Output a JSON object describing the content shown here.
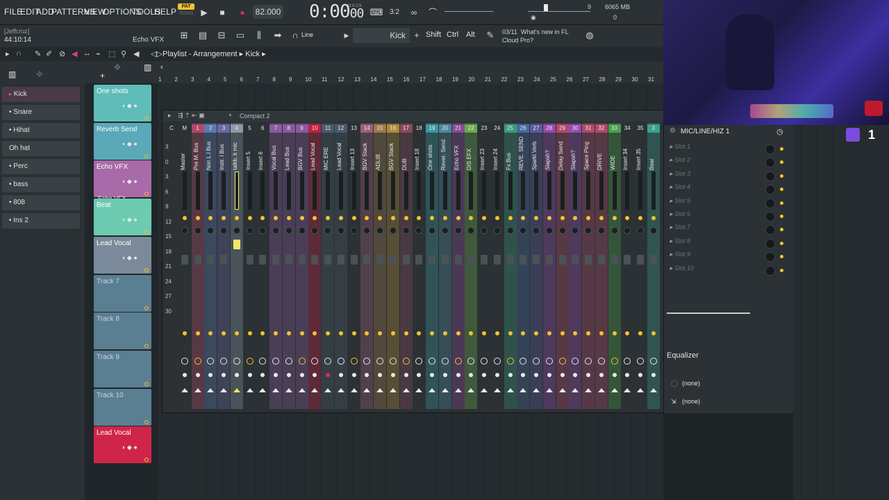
{
  "menu": [
    "FILE",
    "EDIT",
    "ADD",
    "PATTERNS",
    "VIEW",
    "OPTIONS",
    "TOOLS",
    "HELP"
  ],
  "transport": {
    "pat": "PAT",
    "song": "SONG",
    "tempo": "82.000",
    "time": "0:00",
    "time_small": "00",
    "mscs": "M:S:CS"
  },
  "monitor": {
    "cpu_label": "9",
    "mem": "6065 MB",
    "poly": "0"
  },
  "user": "[Jeffcruz]",
  "clock": "44:10:14",
  "focused_channel": "Echo VFX",
  "snap": "Line",
  "pattern_name": "Kick",
  "modkeys": [
    "Shift",
    "Ctrl",
    "Alt"
  ],
  "news": {
    "date": "03/11",
    "line1": "What's new in FL",
    "line2": "Cloud Pro?"
  },
  "playlist": {
    "title": "Playlist - Arrangement",
    "pattern": "Kick"
  },
  "ruler": [
    "1",
    "2",
    "3",
    "4",
    "5",
    "6",
    "7",
    "8",
    "9",
    "10",
    "11",
    "12",
    "13",
    "14",
    "15",
    "16",
    "17",
    "18",
    "19",
    "20",
    "21",
    "22",
    "23",
    "24",
    "25",
    "26",
    "27",
    "28",
    "29",
    "30",
    "31"
  ],
  "channels": [
    "Kick",
    "Snare",
    "Hihat",
    "Oh hat",
    "Perc",
    "bass",
    "808",
    "Ins 2"
  ],
  "tracks": [
    {
      "name": "One shots",
      "color": "#5fbcb8",
      "sub": ""
    },
    {
      "name": "Reverb Send",
      "color": "#5aa8b8",
      "sub": ""
    },
    {
      "name": "Echo VFX",
      "color": "#a86aa8",
      "sub": "Echo VFX"
    },
    {
      "name": "Beat",
      "color": "#6ccbb0",
      "sub": ""
    },
    {
      "name": "Lead Vocal",
      "color": "#7a8a9a",
      "sub": ""
    },
    {
      "name": "Track 7",
      "color": "#6a8aa0",
      "sub": ""
    },
    {
      "name": "Track 8",
      "color": "#6a8aa0",
      "sub": ""
    },
    {
      "name": "Track 9",
      "color": "#6a8aa0",
      "sub": ""
    },
    {
      "name": "Track 10",
      "color": "#6a8aa0",
      "sub": ""
    },
    {
      "name": "Lead Vocal",
      "color": "#d0254a",
      "sub": ""
    }
  ],
  "mixer": {
    "view": "Compact 2",
    "db_scale": [
      "3",
      "0",
      "3",
      "6",
      "9",
      "12",
      "15",
      "18",
      "21",
      "24",
      "27",
      "30"
    ],
    "strips": [
      {
        "num": "C",
        "label": "",
        "color": ""
      },
      {
        "num": "M",
        "label": "Master",
        "color": ""
      },
      {
        "num": "1",
        "label": "Pre M. Bus",
        "color": "#b04a6a"
      },
      {
        "num": "2",
        "label": "Non L.l Bus",
        "color": "#5a7ab0"
      },
      {
        "num": "3",
        "label": "Instr. l Bus",
        "color": "#6a6aa0"
      },
      {
        "num": "4",
        "label": "talkb. k mic",
        "color": "#8a9aa8"
      },
      {
        "num": "5",
        "label": "Insert 5",
        "color": ""
      },
      {
        "num": "6",
        "label": "Insert 6",
        "color": ""
      },
      {
        "num": "7",
        "label": "Vocal Bus",
        "color": "#8a5aa0"
      },
      {
        "num": "8",
        "label": "Lead Bus",
        "color": "#8a5aa0"
      },
      {
        "num": "9",
        "label": "BGV Bus",
        "color": "#8a5aa0"
      },
      {
        "num": "10",
        "label": "Lead Vocal",
        "color": "#c02040"
      },
      {
        "num": "11",
        "label": "MIC ERE",
        "color": "#4a5a6a"
      },
      {
        "num": "12",
        "label": "Lead Vocal",
        "color": "#4a5a6a"
      },
      {
        "num": "13",
        "label": "Insert 13",
        "color": ""
      },
      {
        "num": "14",
        "label": "BGV Stack",
        "color": "#a0607a"
      },
      {
        "num": "15",
        "label": "ADLIB",
        "color": "#a07a4a"
      },
      {
        "num": "16",
        "label": "BGV Stack",
        "color": "#b08a3a"
      },
      {
        "num": "17",
        "label": "DUB",
        "color": "#8a4a5a"
      },
      {
        "num": "18",
        "label": "Insert 18",
        "color": ""
      },
      {
        "num": "19",
        "label": "One shots",
        "color": "#3a9aa0"
      },
      {
        "num": "20",
        "label": "Rever. Send",
        "color": "#4a8aa0"
      },
      {
        "num": "21",
        "label": "Echo VFX",
        "color": "#8a4a9a"
      },
      {
        "num": "22",
        "label": "DIS EFX",
        "color": "#6aaa4a"
      },
      {
        "num": "23",
        "label": "Insert 23",
        "color": ""
      },
      {
        "num": "24",
        "label": "Insert 24",
        "color": ""
      },
      {
        "num": "25",
        "label": "Fx Bus",
        "color": "#3a9a7a"
      },
      {
        "num": "26",
        "label": "REVE. SEND",
        "color": "#4a6aa0"
      },
      {
        "num": "27",
        "label": "Sparkl.Verb",
        "color": "#5a5aa0"
      },
      {
        "num": "28",
        "label": "Slapsh?",
        "color": "#9a4ab0"
      },
      {
        "num": "29",
        "label": "Delay Send",
        "color": "#b04a6a"
      },
      {
        "num": "30",
        "label": "Slapsh?",
        "color": "#9a4ab0"
      },
      {
        "num": "31",
        "label": "Space Ping",
        "color": "#b04a6a"
      },
      {
        "num": "32",
        "label": "DRIVE",
        "color": "#b04a6a"
      },
      {
        "num": "33",
        "label": "WIDE",
        "color": "#4aa04a"
      },
      {
        "num": "34",
        "label": "Insert 34",
        "color": ""
      },
      {
        "num": "35",
        "label": "Insert 35",
        "color": ""
      },
      {
        "num": "3",
        "label": "Beat",
        "color": "#3aa090"
      }
    ]
  },
  "fx_panel": {
    "title": "MIC/LINE/HIZ 1",
    "slots": [
      "Slot 1",
      "Slot 2",
      "Slot 3",
      "Slot 4",
      "Slot 5",
      "Slot 6",
      "Slot 7",
      "Slot 8",
      "Slot 9",
      "Slot 10"
    ],
    "equalizer": "Equalizer",
    "input_none": "(none)",
    "output_none": "(none)"
  },
  "twitch_count": "1",
  "colors": {
    "accent": "#f5c231",
    "record": "#e0304a"
  }
}
